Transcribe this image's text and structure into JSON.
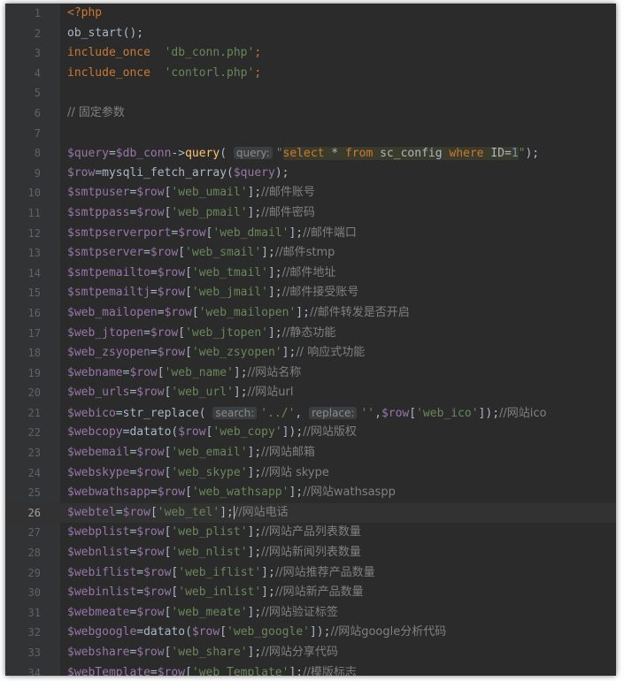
{
  "editor": {
    "current_line": 26,
    "lines": [
      {
        "n": "1",
        "t": [
          [
            "kw",
            "<?php"
          ]
        ]
      },
      {
        "n": "2",
        "t": [
          [
            "plain",
            "ob_start();"
          ]
        ]
      },
      {
        "n": "3",
        "t": [
          [
            "kw",
            "include_once  "
          ],
          [
            "str",
            "'db_conn.php'"
          ],
          [
            "kw",
            ";"
          ]
        ]
      },
      {
        "n": "4",
        "t": [
          [
            "kw",
            "include_once  "
          ],
          [
            "str",
            "'contorl.php'"
          ],
          [
            "kw",
            ";"
          ]
        ]
      },
      {
        "n": "5",
        "t": []
      },
      {
        "n": "6",
        "t": [
          [
            "cm",
            "// 固定参数"
          ]
        ]
      },
      {
        "n": "7",
        "t": []
      },
      {
        "n": "8",
        "t": [
          [
            "var",
            "$query"
          ],
          [
            "plain",
            "="
          ],
          [
            "var",
            "$db_conn"
          ],
          [
            "plain",
            "->"
          ],
          [
            "fn",
            "query"
          ],
          [
            "plain",
            "( "
          ],
          [
            "hint",
            "query:"
          ],
          [
            "str",
            "\""
          ],
          [
            "sql",
            "select"
          ],
          [
            "sqlplain",
            " * "
          ],
          [
            "sql",
            "from"
          ],
          [
            "sqlplain",
            " sc_config "
          ],
          [
            "sql",
            "where"
          ],
          [
            "sqlplain",
            " ID="
          ],
          [
            "num",
            "1"
          ],
          [
            "str",
            "\""
          ],
          [
            "plain",
            ");"
          ]
        ]
      },
      {
        "n": "9",
        "t": [
          [
            "var",
            "$row"
          ],
          [
            "plain",
            "=mysqli_fetch_array("
          ],
          [
            "var",
            "$query"
          ],
          [
            "plain",
            ");"
          ]
        ]
      },
      {
        "n": "10",
        "t": [
          [
            "var",
            "$smtpuser"
          ],
          [
            "plain",
            "="
          ],
          [
            "var",
            "$row"
          ],
          [
            "plain",
            "["
          ],
          [
            "str",
            "'web_umail'"
          ],
          [
            "plain",
            "];"
          ],
          [
            "cm",
            "//邮件账号"
          ]
        ]
      },
      {
        "n": "11",
        "t": [
          [
            "var",
            "$smtppass"
          ],
          [
            "plain",
            "="
          ],
          [
            "var",
            "$row"
          ],
          [
            "plain",
            "["
          ],
          [
            "str",
            "'web_pmail'"
          ],
          [
            "plain",
            "];"
          ],
          [
            "cm",
            "//邮件密码"
          ]
        ]
      },
      {
        "n": "12",
        "t": [
          [
            "var",
            "$smtpserverport"
          ],
          [
            "plain",
            "="
          ],
          [
            "var",
            "$row"
          ],
          [
            "plain",
            "["
          ],
          [
            "str",
            "'web_dmail'"
          ],
          [
            "plain",
            "];"
          ],
          [
            "cm",
            "//邮件端口"
          ]
        ]
      },
      {
        "n": "13",
        "t": [
          [
            "var",
            "$smtpserver"
          ],
          [
            "plain",
            "="
          ],
          [
            "var",
            "$row"
          ],
          [
            "plain",
            "["
          ],
          [
            "str",
            "'web_smail'"
          ],
          [
            "plain",
            "];"
          ],
          [
            "cm",
            "//邮件stmp"
          ]
        ]
      },
      {
        "n": "14",
        "t": [
          [
            "var",
            "$smtpemailto"
          ],
          [
            "plain",
            "="
          ],
          [
            "var",
            "$row"
          ],
          [
            "plain",
            "["
          ],
          [
            "str",
            "'web_tmail'"
          ],
          [
            "plain",
            "];"
          ],
          [
            "cm",
            "//邮件地址"
          ]
        ]
      },
      {
        "n": "15",
        "t": [
          [
            "var",
            "$smtpemailtj"
          ],
          [
            "plain",
            "="
          ],
          [
            "var",
            "$row"
          ],
          [
            "plain",
            "["
          ],
          [
            "str",
            "'web_jmail'"
          ],
          [
            "plain",
            "];"
          ],
          [
            "cm",
            "//邮件接受账号"
          ]
        ]
      },
      {
        "n": "16",
        "t": [
          [
            "var",
            "$web_mailopen"
          ],
          [
            "plain",
            "="
          ],
          [
            "var",
            "$row"
          ],
          [
            "plain",
            "["
          ],
          [
            "str",
            "'web_mailopen'"
          ],
          [
            "plain",
            "];"
          ],
          [
            "cm",
            "//邮件转发是否开启"
          ]
        ]
      },
      {
        "n": "17",
        "t": [
          [
            "var",
            "$web_jtopen"
          ],
          [
            "plain",
            "="
          ],
          [
            "var",
            "$row"
          ],
          [
            "plain",
            "["
          ],
          [
            "str",
            "'web_jtopen'"
          ],
          [
            "plain",
            "];"
          ],
          [
            "cm",
            "//静态功能"
          ]
        ]
      },
      {
        "n": "18",
        "t": [
          [
            "var",
            "$web_zsyopen"
          ],
          [
            "plain",
            "="
          ],
          [
            "var",
            "$row"
          ],
          [
            "plain",
            "["
          ],
          [
            "str",
            "'web_zsyopen'"
          ],
          [
            "plain",
            "];"
          ],
          [
            "cm",
            "// 响应式功能"
          ]
        ]
      },
      {
        "n": "19",
        "t": [
          [
            "var",
            "$webname"
          ],
          [
            "plain",
            "="
          ],
          [
            "var",
            "$row"
          ],
          [
            "plain",
            "["
          ],
          [
            "str",
            "'web_name'"
          ],
          [
            "plain",
            "];"
          ],
          [
            "cm",
            "//网站名称"
          ]
        ]
      },
      {
        "n": "20",
        "t": [
          [
            "var",
            "$web_urls"
          ],
          [
            "plain",
            "="
          ],
          [
            "var",
            "$row"
          ],
          [
            "plain",
            "["
          ],
          [
            "str",
            "'web_url'"
          ],
          [
            "plain",
            "];"
          ],
          [
            "cm",
            "//网站url"
          ]
        ]
      },
      {
        "n": "21",
        "t": [
          [
            "var",
            "$webico"
          ],
          [
            "plain",
            "=str_replace( "
          ],
          [
            "hint",
            "search:"
          ],
          [
            "str",
            "'../'"
          ],
          [
            "plain",
            ", "
          ],
          [
            "hint",
            "replace:"
          ],
          [
            "str",
            "''"
          ],
          [
            "plain",
            ","
          ],
          [
            "var",
            "$row"
          ],
          [
            "plain",
            "["
          ],
          [
            "str",
            "'web_ico'"
          ],
          [
            "plain",
            "]);"
          ],
          [
            "cm",
            "//网站ico"
          ]
        ]
      },
      {
        "n": "22",
        "t": [
          [
            "var",
            "$webcopy"
          ],
          [
            "plain",
            "=datato("
          ],
          [
            "var",
            "$row"
          ],
          [
            "plain",
            "["
          ],
          [
            "str",
            "'web_copy'"
          ],
          [
            "plain",
            "]);"
          ],
          [
            "cm",
            "//网站版权"
          ]
        ]
      },
      {
        "n": "23",
        "t": [
          [
            "var",
            "$webemail"
          ],
          [
            "plain",
            "="
          ],
          [
            "var",
            "$row"
          ],
          [
            "plain",
            "["
          ],
          [
            "str",
            "'web_email'"
          ],
          [
            "plain",
            "];"
          ],
          [
            "cm",
            "//网站邮箱"
          ]
        ]
      },
      {
        "n": "24",
        "t": [
          [
            "var",
            "$webskype"
          ],
          [
            "plain",
            "="
          ],
          [
            "var",
            "$row"
          ],
          [
            "plain",
            "["
          ],
          [
            "str",
            "'web_skype'"
          ],
          [
            "plain",
            "];"
          ],
          [
            "cm",
            "//网站 skype"
          ]
        ]
      },
      {
        "n": "25",
        "t": [
          [
            "var",
            "$webwathsapp"
          ],
          [
            "plain",
            "="
          ],
          [
            "var",
            "$row"
          ],
          [
            "plain",
            "["
          ],
          [
            "str",
            "'web_wathsapp'"
          ],
          [
            "plain",
            "];"
          ],
          [
            "cm",
            "//网站wathsaspp"
          ]
        ]
      },
      {
        "n": "26",
        "t": [
          [
            "var",
            "$webtel"
          ],
          [
            "plain",
            "="
          ],
          [
            "var",
            "$row"
          ],
          [
            "plain",
            "["
          ],
          [
            "str",
            "'web_tel'"
          ],
          [
            "plain",
            "];"
          ],
          [
            "cursor",
            ""
          ],
          [
            "cm",
            "//网站电话"
          ]
        ]
      },
      {
        "n": "27",
        "t": [
          [
            "var",
            "$webplist"
          ],
          [
            "plain",
            "="
          ],
          [
            "var",
            "$row"
          ],
          [
            "plain",
            "["
          ],
          [
            "str",
            "'web_plist'"
          ],
          [
            "plain",
            "];"
          ],
          [
            "cm",
            "//网站产品列表数量"
          ]
        ]
      },
      {
        "n": "28",
        "t": [
          [
            "var",
            "$webnlist"
          ],
          [
            "plain",
            "="
          ],
          [
            "var",
            "$row"
          ],
          [
            "plain",
            "["
          ],
          [
            "str",
            "'web_nlist'"
          ],
          [
            "plain",
            "];"
          ],
          [
            "cm",
            "//网站新闻列表数量"
          ]
        ]
      },
      {
        "n": "29",
        "t": [
          [
            "var",
            "$webiflist"
          ],
          [
            "plain",
            "="
          ],
          [
            "var",
            "$row"
          ],
          [
            "plain",
            "["
          ],
          [
            "str",
            "'web_iflist'"
          ],
          [
            "plain",
            "];"
          ],
          [
            "cm",
            "//网站推荐产品数量"
          ]
        ]
      },
      {
        "n": "30",
        "t": [
          [
            "var",
            "$webinlist"
          ],
          [
            "plain",
            "="
          ],
          [
            "var",
            "$row"
          ],
          [
            "plain",
            "["
          ],
          [
            "str",
            "'web_inlist'"
          ],
          [
            "plain",
            "];"
          ],
          [
            "cm",
            "//网站新产品数量"
          ]
        ]
      },
      {
        "n": "31",
        "t": [
          [
            "var",
            "$webmeate"
          ],
          [
            "plain",
            "="
          ],
          [
            "var",
            "$row"
          ],
          [
            "plain",
            "["
          ],
          [
            "str",
            "'web_meate'"
          ],
          [
            "plain",
            "];"
          ],
          [
            "cm",
            "//网站验证标签"
          ]
        ]
      },
      {
        "n": "32",
        "t": [
          [
            "var",
            "$webgoogle"
          ],
          [
            "plain",
            "=datato("
          ],
          [
            "var",
            "$row"
          ],
          [
            "plain",
            "["
          ],
          [
            "str",
            "'web_google'"
          ],
          [
            "plain",
            "]);"
          ],
          [
            "cm",
            "//网站google分析代码"
          ]
        ]
      },
      {
        "n": "33",
        "t": [
          [
            "var",
            "$webshare"
          ],
          [
            "plain",
            "="
          ],
          [
            "var",
            "$row"
          ],
          [
            "plain",
            "["
          ],
          [
            "str",
            "'web_share'"
          ],
          [
            "plain",
            "];"
          ],
          [
            "cm",
            "//网站分享代码"
          ]
        ]
      },
      {
        "n": "34",
        "t": [
          [
            "var",
            "$webTemplate"
          ],
          [
            "plain",
            "="
          ],
          [
            "var",
            "$row"
          ],
          [
            "plain",
            "["
          ],
          [
            "str",
            "'web_Template'"
          ],
          [
            "plain",
            "];"
          ],
          [
            "cm",
            "//模版标志"
          ]
        ]
      }
    ]
  }
}
